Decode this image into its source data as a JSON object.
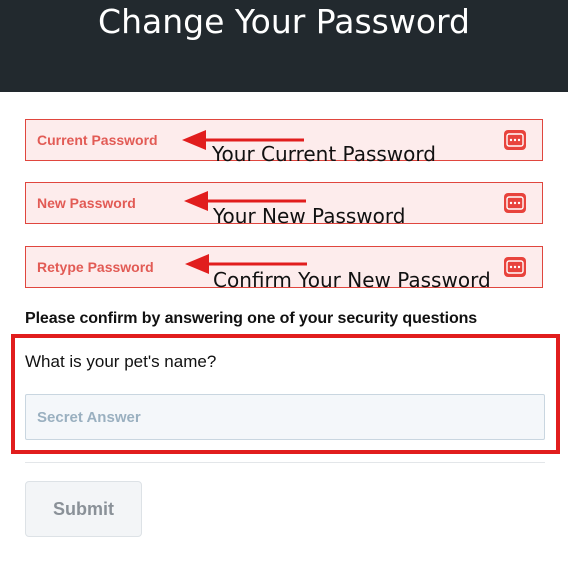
{
  "header": {
    "title": "Change Your Password"
  },
  "fields": {
    "current": {
      "placeholder": "Current Password",
      "annotation": "Your Current Password"
    },
    "new": {
      "placeholder": "New Password",
      "annotation": "Your New Password"
    },
    "retype": {
      "placeholder": "Retype Password",
      "annotation": "Confirm Your New Password"
    }
  },
  "security": {
    "heading": "Please confirm by answering one of your security questions",
    "question": "What is your pet's name?",
    "answer_placeholder": "Secret Answer"
  },
  "submit": {
    "label": "Submit"
  },
  "colors": {
    "header_bg": "#22292e",
    "field_bg": "#fdecec",
    "field_border": "#e0463e",
    "annotation_red": "#e11d1d"
  },
  "icons": {
    "password_field": "password-dots-icon",
    "annotation": "arrow-left-icon"
  }
}
